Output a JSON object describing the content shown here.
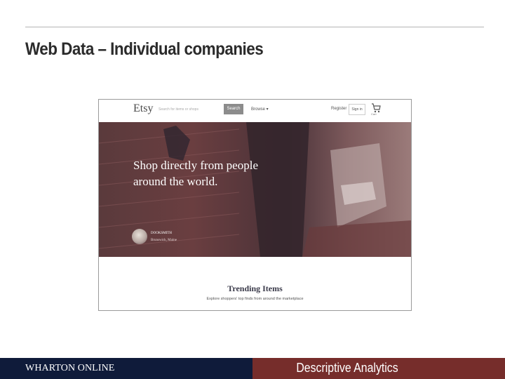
{
  "slide": {
    "title": "Web Data – Individual companies"
  },
  "etsy": {
    "logo": "Etsy",
    "search_placeholder": "Search for items or shops",
    "search_button": "Search",
    "browse": "Browse ▾",
    "register": "Register",
    "sign_in": "Sign in",
    "cart_label": "Cart",
    "hero_headline_1": "Shop directly from people",
    "hero_headline_2": "around the world.",
    "featured_shop": "DOOKSMITH",
    "featured_location": "Brunswick, Maine",
    "trending_title": "Trending Items",
    "trending_subtitle": "Explore shoppers' top finds from around the marketplace",
    "colors": {
      "hero_base": "#5a3a3c",
      "search_button": "#8c8c8c"
    }
  },
  "footer": {
    "brand": "WHARTON ONLINE",
    "course": "Descriptive Analytics",
    "colors": {
      "left": "#0f1b3a",
      "right": "#762d2b"
    }
  }
}
